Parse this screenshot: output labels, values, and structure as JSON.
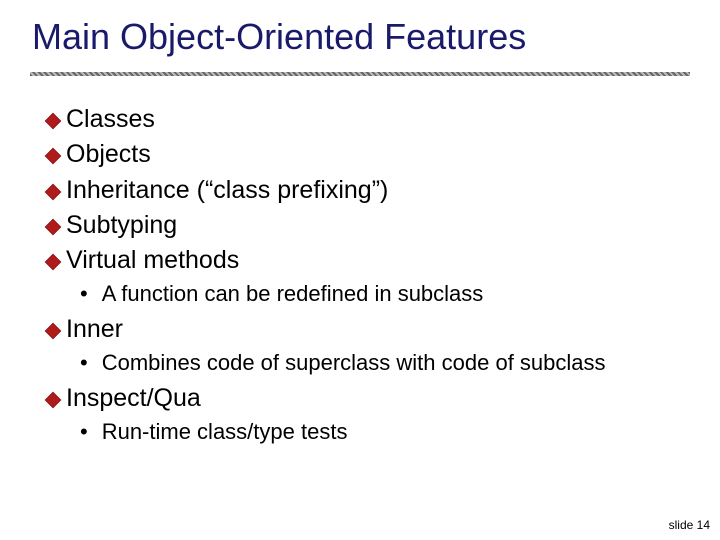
{
  "title": "Main Object-Oriented Features",
  "items": [
    {
      "label": "Classes"
    },
    {
      "label": "Objects"
    },
    {
      "label": "Inheritance (“class prefixing”)"
    },
    {
      "label": "Subtyping"
    },
    {
      "label": "Virtual methods",
      "sub": [
        "A function can be redefined in subclass"
      ]
    },
    {
      "label": "Inner",
      "sub": [
        "Combines code of superclass with code of subclass"
      ]
    },
    {
      "label": "Inspect/Qua",
      "sub": [
        "Run-time class/type tests"
      ]
    }
  ],
  "footer": "slide 14",
  "colors": {
    "title": "#1a1a6a",
    "diamond": "#b11a1a"
  }
}
